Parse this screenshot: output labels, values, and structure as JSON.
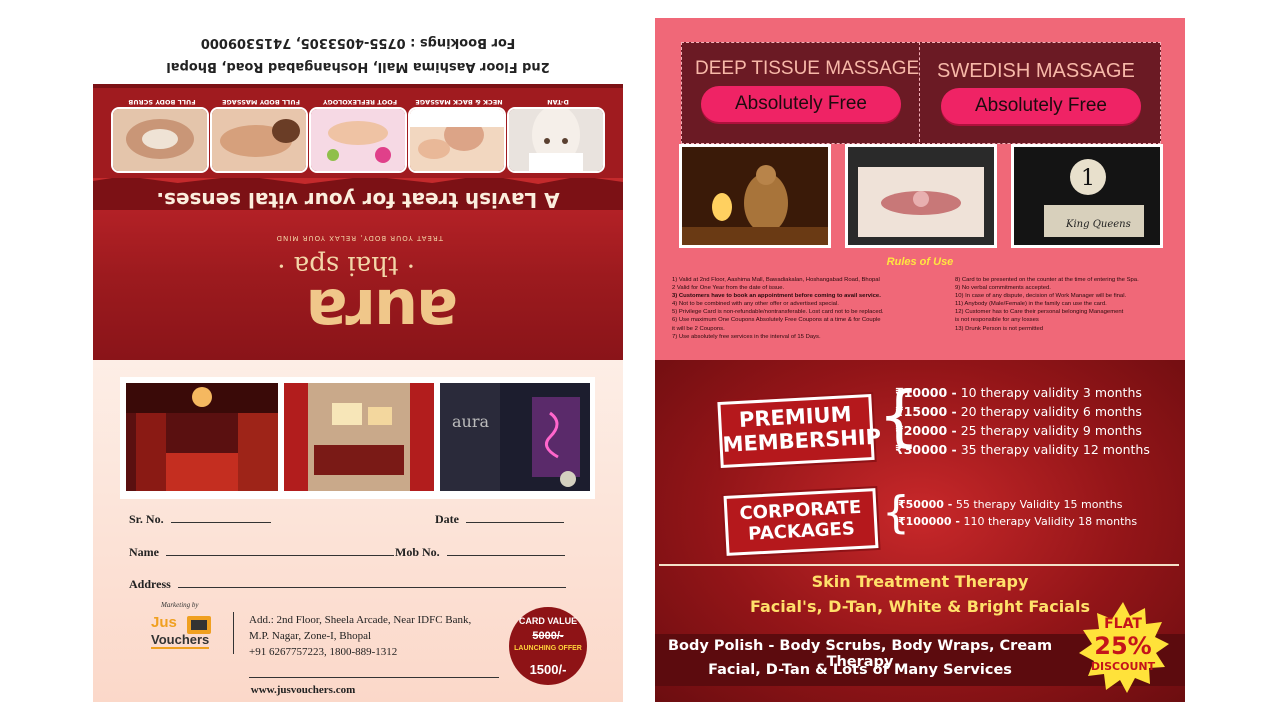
{
  "left_panel": {
    "brand": {
      "logo_word": "aura",
      "sub": "· thai spa ·",
      "small_tag": "TREAT YOUR BODY, RELAX YOUR MIND",
      "tagline": "A Lavish treat for your vital senses."
    },
    "services": [
      "D-TAN",
      "NECK & BACK MASSAGE",
      "FOOT REFLEXOLOGY",
      "FULL BODY MASSAGE",
      "FULL BODY SCRUB"
    ],
    "address": "2nd Floor Aashima Mall, Hoshangabad Road, Bhopal",
    "bookings": "For Bookings : 0755-4053305, 7415309000",
    "form": {
      "sr_label": "Sr. No.",
      "date_label": "Date",
      "name_label": "Name",
      "mob_label": "Mob No.",
      "address_label": "Address"
    },
    "marketing": {
      "by": "Marketing by",
      "logo_top": "Jus",
      "logo_bottom": "Vouchers",
      "addr1": "Add.: 2nd Floor, Sheela Arcade, Near IDFC Bank,",
      "addr2": "M.P. Nagar, Zone-I, Bhopal",
      "phone": "+91 6267757223, 1800-889-1312",
      "web": "www.jusvouchers.com"
    },
    "card": {
      "label": "CARD VALUE",
      "old_value": "5000/-",
      "offer": "LAUNCHING OFFER",
      "new_value": "1500/-"
    }
  },
  "right_panel": {
    "offers": [
      {
        "title": "DEEP TISSUE MASSAGE",
        "badge": "Absolutely Free"
      },
      {
        "title": "SWEDISH MASSAGE",
        "badge": "Absolutely Free"
      }
    ],
    "rules_title": "Rules of Use",
    "rules_left": [
      "1)    Valid at 2nd Floor, Aashima Mall, Bawadiakalan, Hoshangabad Road, Bhopal",
      "2     Valid for One Year from the date of issue.",
      "3)    Customers have to book an appointment before coming to avail service.",
      "4)    Not to be combined with any other offer or advertised special.",
      "5)    Privilege Card is non-refundable/nontransferable. Lost card not to be replaced.",
      "6)    Use maximum One Coupons Absolutely Free Coupons at a time & for Couple",
      "         it will be 2 Coupons.",
      "7)    Use absolutely free services in the interval of 15 Days."
    ],
    "rules_right": [
      "8)    Card to be presented on the counter at the time of entering the Spa.",
      "9)    No verbal commitments accepted.",
      "10)   In case of any dispute, decision of Work Manager will be final.",
      "11)   Anybody (Male/Female) in the family can use the card.",
      "12)   Customer has to Care their personal belonging Management",
      "          is not responsible for any losses",
      "13)   Drunk Person is not permitted"
    ],
    "premium": {
      "line1": "PREMIUM",
      "line2": "MEMBERSHIP",
      "plans": [
        {
          "price": "₹10000 -",
          "desc": " 10 therapy validity 3 months"
        },
        {
          "price": "₹15000 -",
          "desc": " 20 therapy validity 6 months"
        },
        {
          "price": "₹20000 -",
          "desc": " 25 therapy validity 9 months"
        },
        {
          "price": "₹30000 -",
          "desc": " 35 therapy validity 12 months"
        }
      ]
    },
    "corporate": {
      "line1": "CORPORATE",
      "line2": "PACKAGES",
      "plans": [
        {
          "price": "₹50000 -",
          "desc": " 55 therapy Validity 15 months"
        },
        {
          "price": "₹100000 -",
          "desc": " 110 therapy Validity 18 months"
        }
      ]
    },
    "skin_title": "Skin Treatment Therapy",
    "skin_sub": "Facial's, D-Tan, White & Bright Facials",
    "body_line1": "Body Polish - Body Scrubs, Body Wraps, Cream Therapy",
    "body_line2": "Facial, D-Tan & Lots of Many Services",
    "discount": {
      "top": "FLAT",
      "value": "25%",
      "bottom": "DISCOUNT"
    }
  },
  "colors": {
    "maroon": "#7c1115",
    "pink": "#f06878",
    "gold": "#ffe06a",
    "magenta_pill": "#ef2365"
  }
}
